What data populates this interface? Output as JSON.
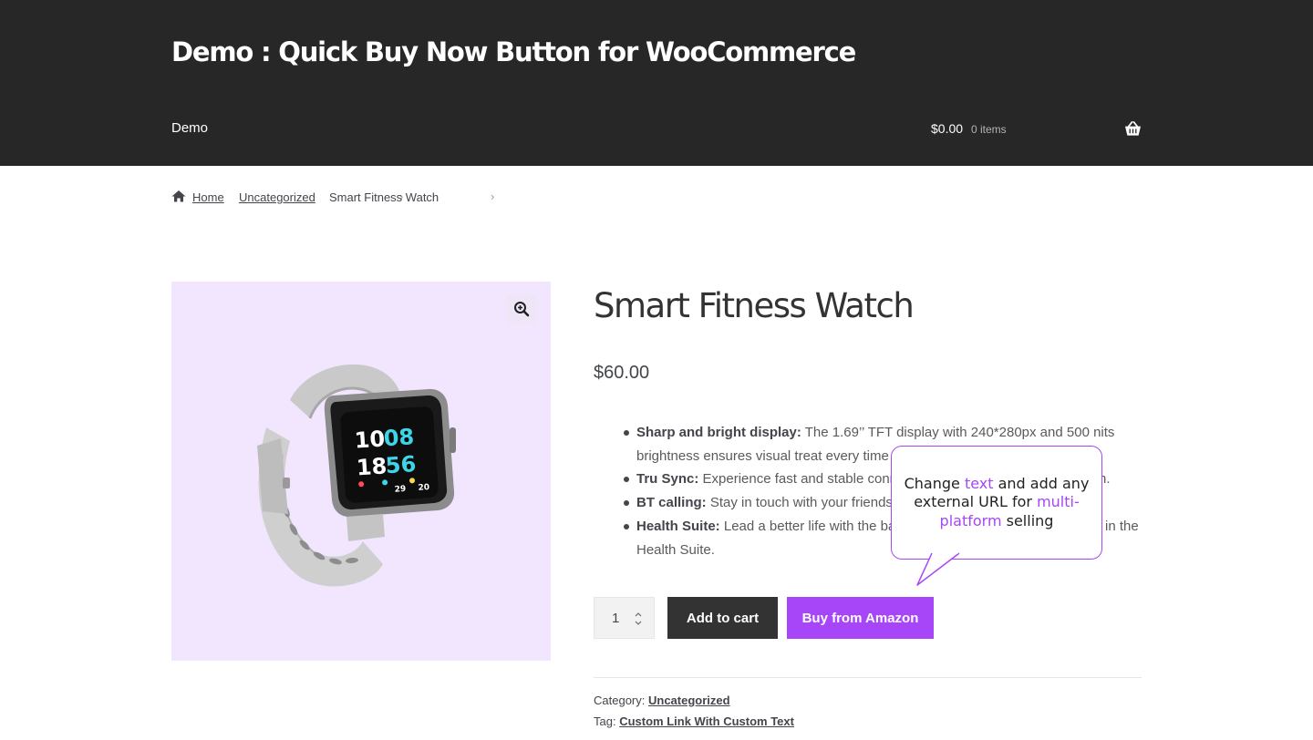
{
  "header": {
    "site_title": "Demo : Quick Buy Now Button for WooCommerce",
    "nav_demo": "Demo",
    "cart_amount": "$0.00",
    "cart_count": "0 items",
    "basket_icon": "basket-icon"
  },
  "breadcrumb": {
    "home_icon": "home-icon",
    "home": "Home",
    "category": "Uncategorized",
    "current": "Smart Fitness Watch",
    "separator": "›"
  },
  "product": {
    "title": "Smart Fitness Watch",
    "price": "$60.00",
    "image_bg": "#f2e6ff",
    "zoom_icon": "zoom-in-icon",
    "watch_display": {
      "hour": "10",
      "minute": "08",
      "second_a": "18",
      "second_b": "56",
      "stat_a": "29",
      "stat_b": "20"
    },
    "description": [
      {
        "label": "Sharp and bright display:",
        "text": " The 1.69’’ TFT display with 240*280px and 500 nits brightness ensures visual treat every time"
      },
      {
        "label": "Tru Sync:",
        "text": " Experience fast and stable conne"
      },
      {
        "label": "BT calling:",
        "text": " Stay in touch with your friends"
      },
      {
        "label": "Health Suite:",
        "text": " Lead a better life with the ba"
      }
    ],
    "desc_tails": {
      "tru_sync": "n.",
      "health_suite_a": "in the",
      "health_suite_b": "Health Suite."
    }
  },
  "purchase": {
    "quantity": "1",
    "add_to_cart": "Add to cart",
    "buy_from_amazon": "Buy from Amazon",
    "accent_color": "#a646f8"
  },
  "callout": {
    "text_1": "Change ",
    "highlight_1": "text",
    "text_2": " and add any external URL for ",
    "highlight_2": "multi-platform",
    "text_3": " selling"
  },
  "meta": {
    "category_label": "Category:",
    "category_value": "Uncategorized",
    "tag_label": "Tag:",
    "tag_value": "Custom Link With Custom Text"
  }
}
